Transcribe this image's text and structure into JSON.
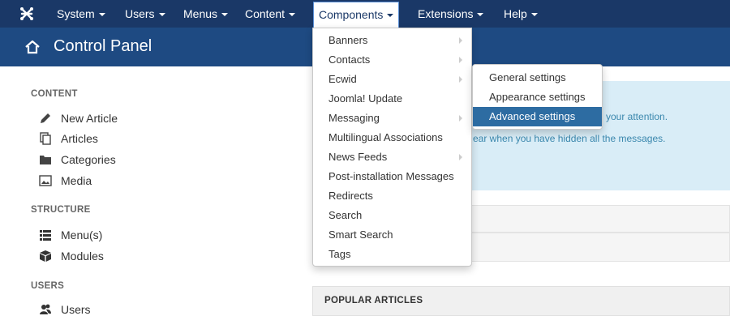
{
  "navbar": {
    "items": [
      {
        "label": "System"
      },
      {
        "label": "Users"
      },
      {
        "label": "Menus"
      },
      {
        "label": "Content"
      },
      {
        "label": "Components"
      },
      {
        "label": "Extensions"
      },
      {
        "label": "Help"
      }
    ],
    "active": "Components"
  },
  "header": {
    "title": "Control Panel",
    "icon": "home-icon"
  },
  "sidebar": {
    "content_title": "CONTENT",
    "content_items": [
      {
        "label": "New Article",
        "icon": "pencil-icon"
      },
      {
        "label": "Articles",
        "icon": "copy-icon"
      },
      {
        "label": "Categories",
        "icon": "folder-icon"
      },
      {
        "label": "Media",
        "icon": "image-icon"
      }
    ],
    "structure_title": "STRUCTURE",
    "structure_items": [
      {
        "label": "Menu(s)",
        "icon": "list-icon"
      },
      {
        "label": "Modules",
        "icon": "cube-icon"
      }
    ],
    "users_title": "USERS",
    "users_items": [
      {
        "label": "Users",
        "icon": "users-icon"
      }
    ]
  },
  "messages": {
    "line1": "your attention.",
    "line2": "ear when you have hidden all the messages."
  },
  "popular": {
    "title": "POPULAR ARTICLES"
  },
  "dropdown": {
    "items": [
      {
        "label": "Banners",
        "submenu": true
      },
      {
        "label": "Contacts",
        "submenu": true
      },
      {
        "label": "Ecwid",
        "submenu": true
      },
      {
        "label": "Joomla! Update",
        "submenu": false
      },
      {
        "label": "Messaging",
        "submenu": true
      },
      {
        "label": "Multilingual Associations",
        "submenu": false
      },
      {
        "label": "News Feeds",
        "submenu": true
      },
      {
        "label": "Post-installation Messages",
        "submenu": false
      },
      {
        "label": "Redirects",
        "submenu": false
      },
      {
        "label": "Search",
        "submenu": false
      },
      {
        "label": "Smart Search",
        "submenu": false
      },
      {
        "label": "Tags",
        "submenu": false
      }
    ]
  },
  "submenu": {
    "items": [
      {
        "label": "General settings"
      },
      {
        "label": "Appearance settings"
      },
      {
        "label": "Advanced settings"
      }
    ],
    "highlighted": "Advanced settings"
  },
  "colors": {
    "navbar": "#1a3867",
    "header": "#1e4a82",
    "highlight": "#2d6ca2",
    "info_bg": "#d9edf7",
    "info_text": "#3a87ad"
  }
}
